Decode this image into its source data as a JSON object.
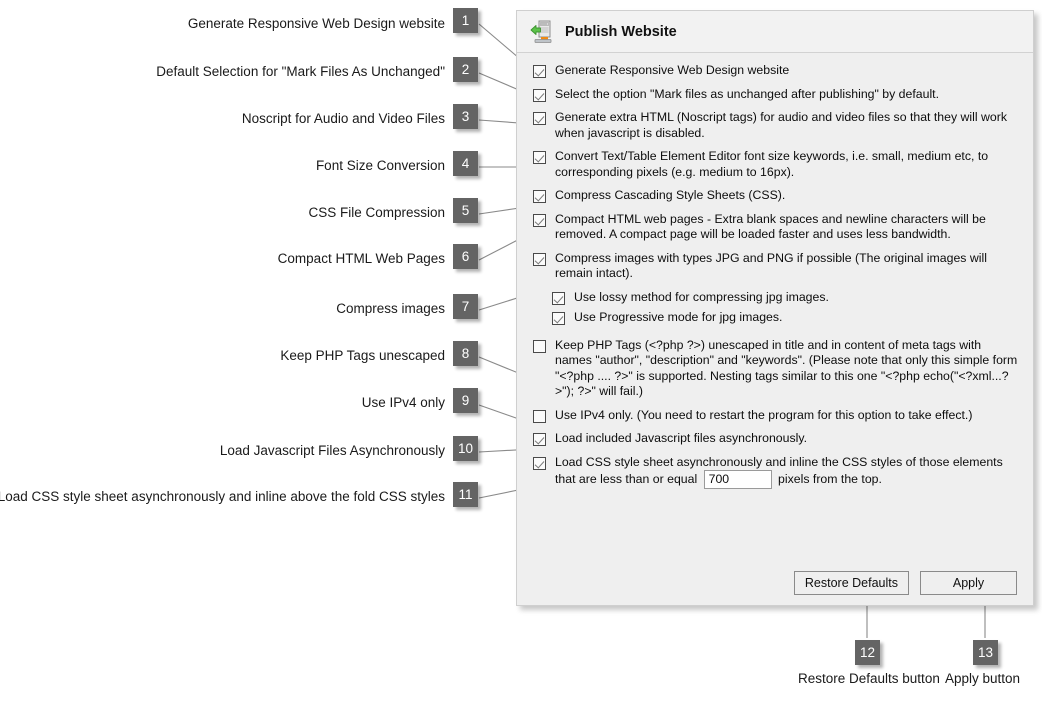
{
  "dialog": {
    "title": "Publish Website",
    "icon": "publish-website-icon",
    "options": [
      {
        "checked": true,
        "indent": false,
        "text": "Generate Responsive Web Design website"
      },
      {
        "checked": true,
        "indent": false,
        "text": "Select the option \"Mark files as unchanged after publishing\" by default."
      },
      {
        "checked": true,
        "indent": false,
        "text": "Generate extra HTML (Noscript tags) for audio and video files so that they will work when javascript is disabled."
      },
      {
        "checked": true,
        "indent": false,
        "text": "Convert Text/Table Element Editor font size keywords, i.e. small, medium etc, to corresponding pixels (e.g. medium to 16px)."
      },
      {
        "checked": true,
        "indent": false,
        "text": "Compress Cascading Style Sheets (CSS)."
      },
      {
        "checked": true,
        "indent": false,
        "text": "Compact HTML web pages - Extra blank spaces and newline characters will be removed. A compact page will be loaded faster and uses less bandwidth."
      },
      {
        "checked": true,
        "indent": false,
        "text": "Compress images with types JPG and PNG if possible (The original images will remain intact)."
      },
      {
        "checked": true,
        "indent": true,
        "text": "Use lossy method for compressing jpg images."
      },
      {
        "checked": true,
        "indent": true,
        "text": "Use Progressive mode for jpg images."
      },
      {
        "checked": false,
        "indent": false,
        "text": "Keep PHP Tags (<?php ?>) unescaped in title and in content of meta tags with names \"author\", \"description\" and \"keywords\". (Please note that only this simple form \"<?php .... ?>\" is supported. Nesting tags similar to this one \"<?php echo(\"<?xml...?>\"); ?>\" will fail.)"
      },
      {
        "checked": false,
        "indent": false,
        "text": "Use IPv4 only. (You need to restart the program for this option to take effect.)"
      },
      {
        "checked": true,
        "indent": false,
        "text": "Load included Javascript files asynchronously."
      }
    ],
    "css_async_option": {
      "checked": true,
      "text_before": "Load CSS style sheet asynchronously and inline the CSS styles of those elements that are less than or equal",
      "value": "700",
      "text_after": "pixels from the top."
    },
    "buttons": {
      "restore_defaults": "Restore Defaults",
      "apply": "Apply"
    }
  },
  "annotations": {
    "badge_color": "#646464",
    "items": [
      {
        "number": "1",
        "label": "Generate Responsive Web Design website"
      },
      {
        "number": "2",
        "label": "Default Selection for \"Mark Files As Unchanged\""
      },
      {
        "number": "3",
        "label": "Noscript for Audio and Video Files"
      },
      {
        "number": "4",
        "label": "Font Size Conversion"
      },
      {
        "number": "5",
        "label": "CSS File Compression"
      },
      {
        "number": "6",
        "label": "Compact HTML Web Pages"
      },
      {
        "number": "7",
        "label": "Compress images"
      },
      {
        "number": "8",
        "label": "Keep PHP Tags unescaped"
      },
      {
        "number": "9",
        "label": "Use IPv4 only"
      },
      {
        "number": "10",
        "label": "Load Javascript Files Asynchronously"
      },
      {
        "number": "11",
        "label": "Load CSS style sheet asynchronously and inline above the fold CSS styles"
      },
      {
        "number": "12",
        "label": "Restore Defaults button"
      },
      {
        "number": "13",
        "label": "Apply button"
      }
    ]
  }
}
